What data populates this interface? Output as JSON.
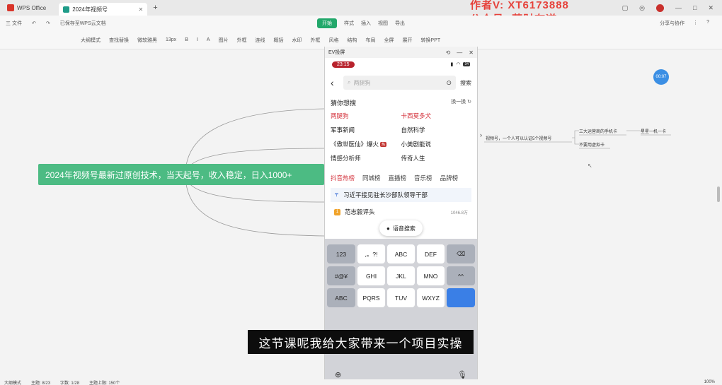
{
  "titlebar": {
    "app_name": "WPS Office",
    "doc_tab": "2024年视频号",
    "new_tab": "+",
    "watermark_line1": "作者V: XT6173888",
    "watermark_line2": "公众号: 获财有道"
  },
  "menubar": {
    "left": [
      "三 文件",
      "已保存至WPS云文档"
    ],
    "tabs": [
      "开始",
      "样式",
      "插入",
      "视图",
      "导出"
    ],
    "right": [
      "分享与协作",
      "⋮",
      "?"
    ]
  },
  "toolbar": {
    "items": [
      "大纲模式",
      "查找替换",
      "微软雅黑",
      "13px",
      "B",
      "I",
      "A",
      "图片",
      "外框",
      "连线",
      "概括",
      "水印",
      "外框",
      "风格",
      "结构",
      "布局",
      "全屏",
      "展开",
      "转换PPT"
    ]
  },
  "mindmap": {
    "root": "2024年视频号最新过原创技术，当天起号，收入稳定，日入1000+",
    "branch_main": "视频号，一个人可以认证5个视频号",
    "leaf1": "三大运营商的手机卡",
    "leaf1_child": "星星一机一卡",
    "leaf2": "不要用虚拟卡",
    "timer": "00:07"
  },
  "phone": {
    "window_title": "EV投屏",
    "time": "23:15",
    "battery": "34",
    "search_placeholder": "两腿狗",
    "search_button": "搜索",
    "guess_title": "猜你想搜",
    "guess_swap": "换一换",
    "guess_items": [
      "两腿狗",
      "卡西莫多犬",
      "军事新闻",
      "自然科学",
      "《傲世医仙》爆火",
      "小美剧能说",
      "情感分析师",
      "传奇人生"
    ],
    "hot_badge": "热",
    "tabs": [
      "抖音热榜",
      "同城榜",
      "直播榜",
      "音乐榜",
      "品牌榜"
    ],
    "hot_item1": "习近平接见驻长沙部队领导干部",
    "hot_item2": "范志毅评头",
    "hot_item2_count": "1046.8万",
    "voice_search": "语音搜索",
    "keyboard_rows": [
      [
        "123",
        ",。?!",
        "ABC",
        "DEF",
        "⌫"
      ],
      [
        "#@¥",
        "GHI",
        "JKL",
        "MNO",
        "^^"
      ],
      [
        "ABC",
        "PQRS",
        "TUV",
        "WXYZ",
        ""
      ]
    ]
  },
  "subtitle": "这节课呢我给大家带来一个项目实操",
  "status": {
    "items": [
      "大纲模式",
      "主题: 8/23",
      "字数: 1/28",
      "主题上限: 150个"
    ],
    "zoom": "100%"
  },
  "colors": {
    "accent_green": "#4cbb83",
    "wps_red": "#d9352a",
    "douyin_red": "#d3303a"
  }
}
